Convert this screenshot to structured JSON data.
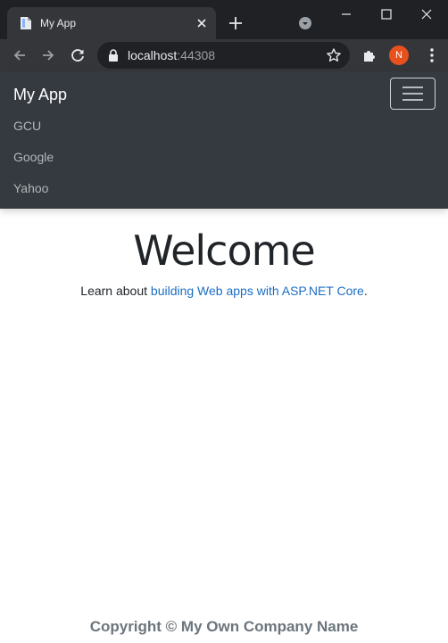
{
  "browser": {
    "tab_title": "My App",
    "url_host": "localhost",
    "url_port": ":44308",
    "profile_initial": "N"
  },
  "navbar": {
    "brand": "My App",
    "links": [
      "GCU",
      "Google",
      "Yahoo"
    ]
  },
  "main": {
    "heading": "Welcome",
    "lead_prefix": "Learn about ",
    "lead_link": "building Web apps with ASP.NET Core",
    "lead_suffix": "."
  },
  "footer": {
    "copyright": "Copyright © My Own Company Name"
  },
  "colors": {
    "navbar_bg": "#343a40",
    "link": "#1b6ec2",
    "avatar": "#e8501e"
  }
}
